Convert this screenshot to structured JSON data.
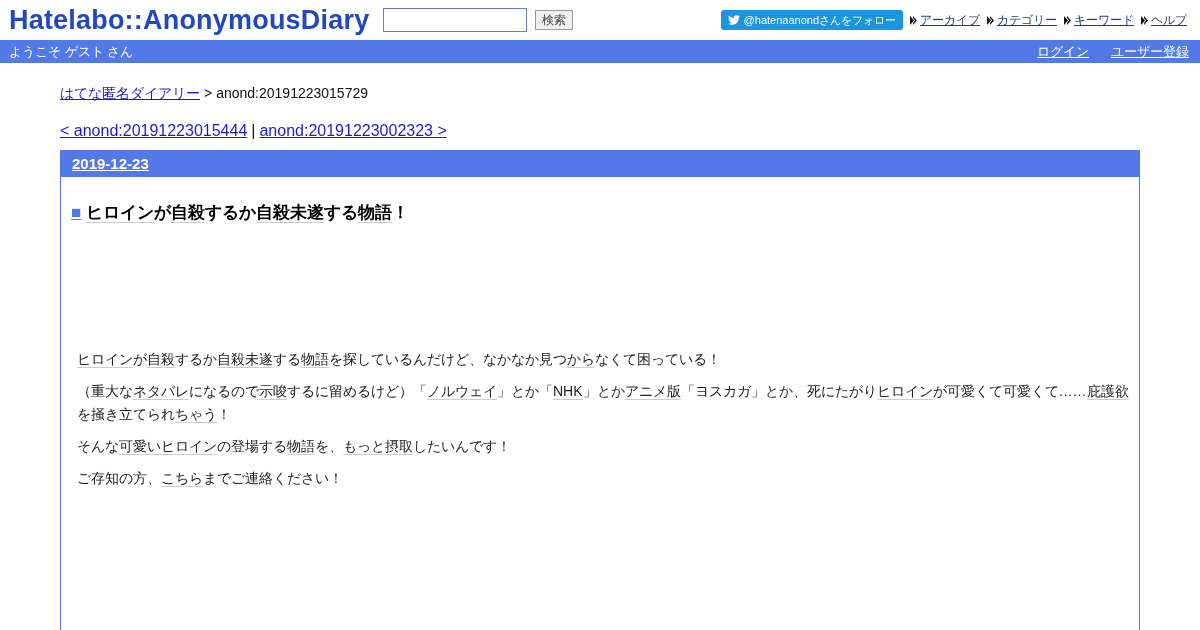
{
  "header": {
    "logo": "Hatelabo::AnonymousDiary",
    "search": {
      "button": "検索"
    },
    "follow_button": "@hatenaanondさんをフォロー",
    "links": [
      "アーカイブ",
      "カテゴリー",
      "キーワード",
      "ヘルプ"
    ]
  },
  "user_bar": {
    "greeting": "ようこそ ゲスト さん",
    "links": [
      "ログイン",
      "ユーザー登録"
    ]
  },
  "breadcrumb": {
    "link": "はてな匿名ダイアリー",
    "separator": ">",
    "current": "anond:20191223015729"
  },
  "pager": {
    "prev": "< anond:20191223015444",
    "separator": "|",
    "next": "anond:20191223002323 >"
  },
  "entry": {
    "date": "2019-12-23",
    "title": {
      "marker": "■",
      "segments": [
        {
          "text": "ヒロイン",
          "keyword": true
        },
        {
          "text": "が",
          "keyword": false
        },
        {
          "text": "自殺",
          "keyword": true
        },
        {
          "text": "するか",
          "keyword": false
        },
        {
          "text": "自殺未遂",
          "keyword": true
        },
        {
          "text": "する",
          "keyword": false
        },
        {
          "text": "物語",
          "keyword": true
        },
        {
          "text": "！",
          "keyword": false
        }
      ]
    },
    "paragraphs": [
      {
        "segments": [
          {
            "text": "ヒロイン",
            "keyword": true
          },
          {
            "text": "が",
            "keyword": false
          },
          {
            "text": "自殺",
            "keyword": true
          },
          {
            "text": "するか",
            "keyword": false
          },
          {
            "text": "自殺未遂",
            "keyword": true
          },
          {
            "text": "する",
            "keyword": false
          },
          {
            "text": "物語",
            "keyword": true
          },
          {
            "text": "を探しているんだけど、なかなか見つ",
            "keyword": false
          },
          {
            "text": "から",
            "keyword": true
          },
          {
            "text": "なくて困っている！",
            "keyword": false
          }
        ]
      },
      {
        "segments": [
          {
            "text": "（重大な",
            "keyword": false
          },
          {
            "text": "ネタバレ",
            "keyword": true
          },
          {
            "text": "になるので",
            "keyword": false
          },
          {
            "text": "示唆",
            "keyword": true
          },
          {
            "text": "するに留めるけど）「",
            "keyword": false
          },
          {
            "text": "ノルウェイ",
            "keyword": true
          },
          {
            "text": "」とか「",
            "keyword": false
          },
          {
            "text": "NHK",
            "keyword": true
          },
          {
            "text": "」とか",
            "keyword": false
          },
          {
            "text": "アニメ版",
            "keyword": true
          },
          {
            "text": "「ヨスカガ」とか、死にたがり",
            "keyword": false
          },
          {
            "text": "ヒロイン",
            "keyword": true
          },
          {
            "text": "が可愛くて可愛くて……",
            "keyword": false
          },
          {
            "text": "庇護欲",
            "keyword": true
          },
          {
            "text": "を掻き立てられ",
            "keyword": false
          },
          {
            "text": "ちゃう",
            "keyword": true
          },
          {
            "text": "！",
            "keyword": false
          }
        ]
      },
      {
        "segments": [
          {
            "text": "そんな",
            "keyword": false
          },
          {
            "text": "可愛い",
            "keyword": true
          },
          {
            "text": "ヒロイン",
            "keyword": true
          },
          {
            "text": "の登場する",
            "keyword": false
          },
          {
            "text": "物語",
            "keyword": true
          },
          {
            "text": "を、",
            "keyword": false
          },
          {
            "text": "もっと",
            "keyword": true
          },
          {
            "text": "摂取",
            "keyword": true
          },
          {
            "text": "したいんです！",
            "keyword": false
          }
        ]
      },
      {
        "segments": [
          {
            "text": "ご存知の方、",
            "keyword": false
          },
          {
            "text": "こちら",
            "keyword": true
          },
          {
            "text": "までご連絡ください！",
            "keyword": false
          }
        ]
      }
    ]
  }
}
